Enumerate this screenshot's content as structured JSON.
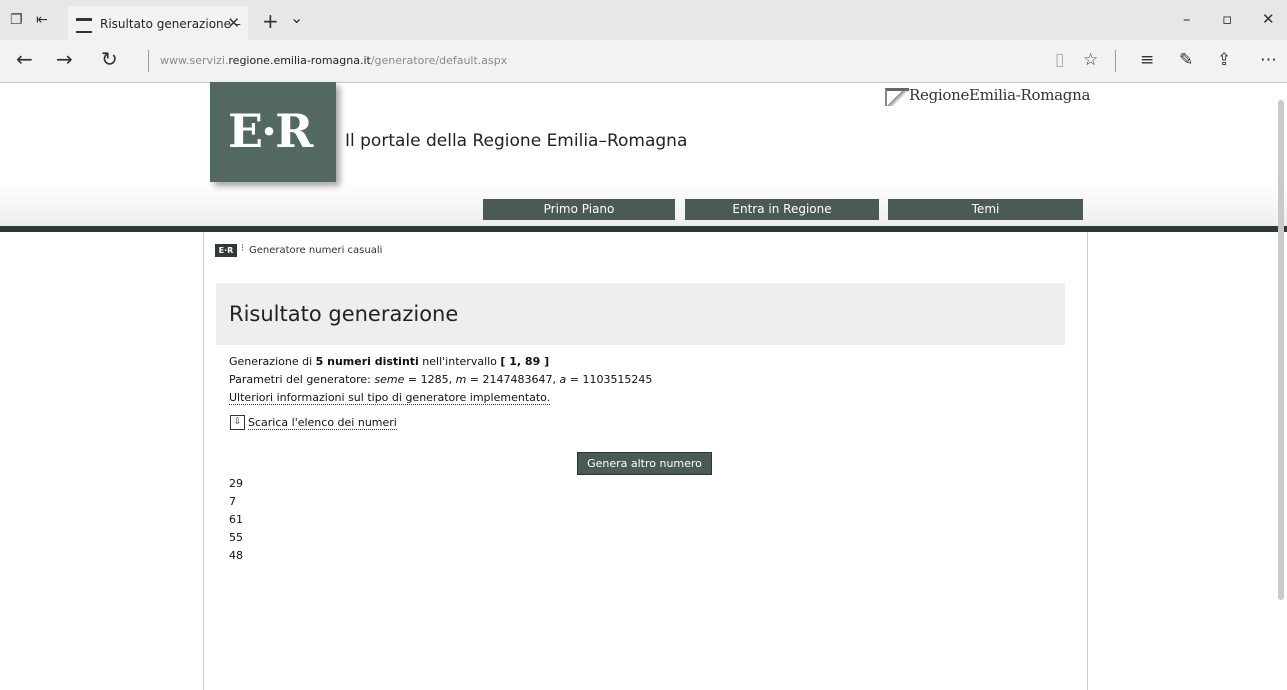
{
  "browser": {
    "tab_title": "Risultato generazione –",
    "url_prefix": "www.servizi.",
    "url_domain": "regione.emilia-romagna.it",
    "url_path": "/generatore/default.aspx"
  },
  "header": {
    "logo_text": "E·R",
    "portal_title": "Il portale della Regione Emilia–Romagna",
    "brand_name": "RegioneEmilia-Romagna",
    "nav": [
      "Primo Piano",
      "Entra in Regione",
      "Temi"
    ]
  },
  "breadcrumb": {
    "logo_text": "E·R",
    "label": "Generatore numeri casuali"
  },
  "result": {
    "title": "Risultato generazione",
    "line1_prefix": "Generazione di ",
    "line1_count": "5",
    "line1_bold": " numeri distinti",
    "line1_mid": " nell'intervallo ",
    "line1_range": "[ 1, 89 ]",
    "line2_prefix": "Parametri del generatore: ",
    "line2_seme": "seme",
    "line2_seme_val": " = 1285, ",
    "line2_m": "m",
    "line2_m_val": " = 2147483647, ",
    "line2_a": "a",
    "line2_a_val": " = 1103515245",
    "info_link": "Ulteriori informazioni sul tipo di generatore implementato.",
    "download_link": "Scarica l'elenco dei numeri",
    "generate_button": "Genera altro numero",
    "numbers": [
      "29",
      "7",
      "61",
      "55",
      "48"
    ]
  }
}
